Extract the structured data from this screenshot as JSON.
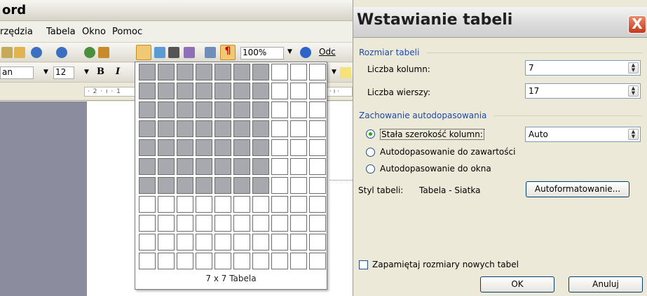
{
  "word": {
    "title": "ord",
    "menu": [
      "rzędzia",
      "Tabela",
      "Okno",
      "Pomoc"
    ],
    "toolbar": {
      "zoom": "100%",
      "read_label": "Odc"
    },
    "format": {
      "font_name": "an",
      "font_size": "12",
      "bold": "B",
      "italic": "I"
    },
    "ruler_text": "· 2 · ı · 1",
    "ruler_text_right": "· ı ·",
    "grid": {
      "rows": 11,
      "cols": 10,
      "selected_rows": 7,
      "selected_cols": 7,
      "label": "7 x 7 Tabela"
    }
  },
  "dialog": {
    "title": "Wstawianie tabeli",
    "close_icon": "X",
    "section_size": "Rozmiar tabeli",
    "cols_label": "Liczba kolumn:",
    "cols_value": "7",
    "rows_label": "Liczba wierszy:",
    "rows_value": "17",
    "section_autofit": "Zachowanie autodopasowania",
    "radio_fixed": "Stała szerokość kolumn:",
    "fixed_value": "Auto",
    "radio_content": "Autodopasowanie do zawartości",
    "radio_window": "Autodopasowanie do okna",
    "style_label": "Styl tabeli:",
    "style_value": "Tabela - Siatka",
    "autoformat_button": "Autoformatowanie...",
    "remember_label": "Zapamiętaj rozmiary nowych tabel",
    "ok": "OK",
    "cancel": "Anuluj"
  }
}
